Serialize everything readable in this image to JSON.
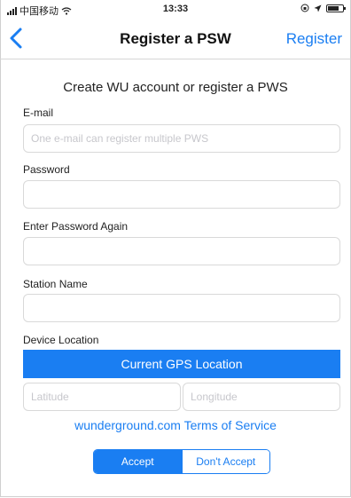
{
  "status_bar": {
    "carrier": "中国移动",
    "time": "13:33"
  },
  "nav": {
    "title": "Register a PSW",
    "action_label": "Register",
    "back_icon": "chevron-left-icon"
  },
  "form": {
    "heading": "Create WU account or register a PWS",
    "email_label": "E-mail",
    "email_placeholder": "One e-mail can register multiple PWS",
    "email_value": "",
    "password_label": "Password",
    "password_value": "",
    "password_again_label": "Enter Password Again",
    "password_again_value": "",
    "station_name_label": "Station Name",
    "station_name_value": "",
    "device_location_label": "Device Location",
    "gps_button_label": "Current GPS Location",
    "latitude_placeholder": "Latitude",
    "longitude_placeholder": "Longitude"
  },
  "terms": {
    "link_text": "wunderground.com Terms of Service",
    "accept_label": "Accept",
    "dont_accept_label": "Don't Accept",
    "selected": "Accept"
  },
  "colors": {
    "accent": "#1a7ef2"
  }
}
